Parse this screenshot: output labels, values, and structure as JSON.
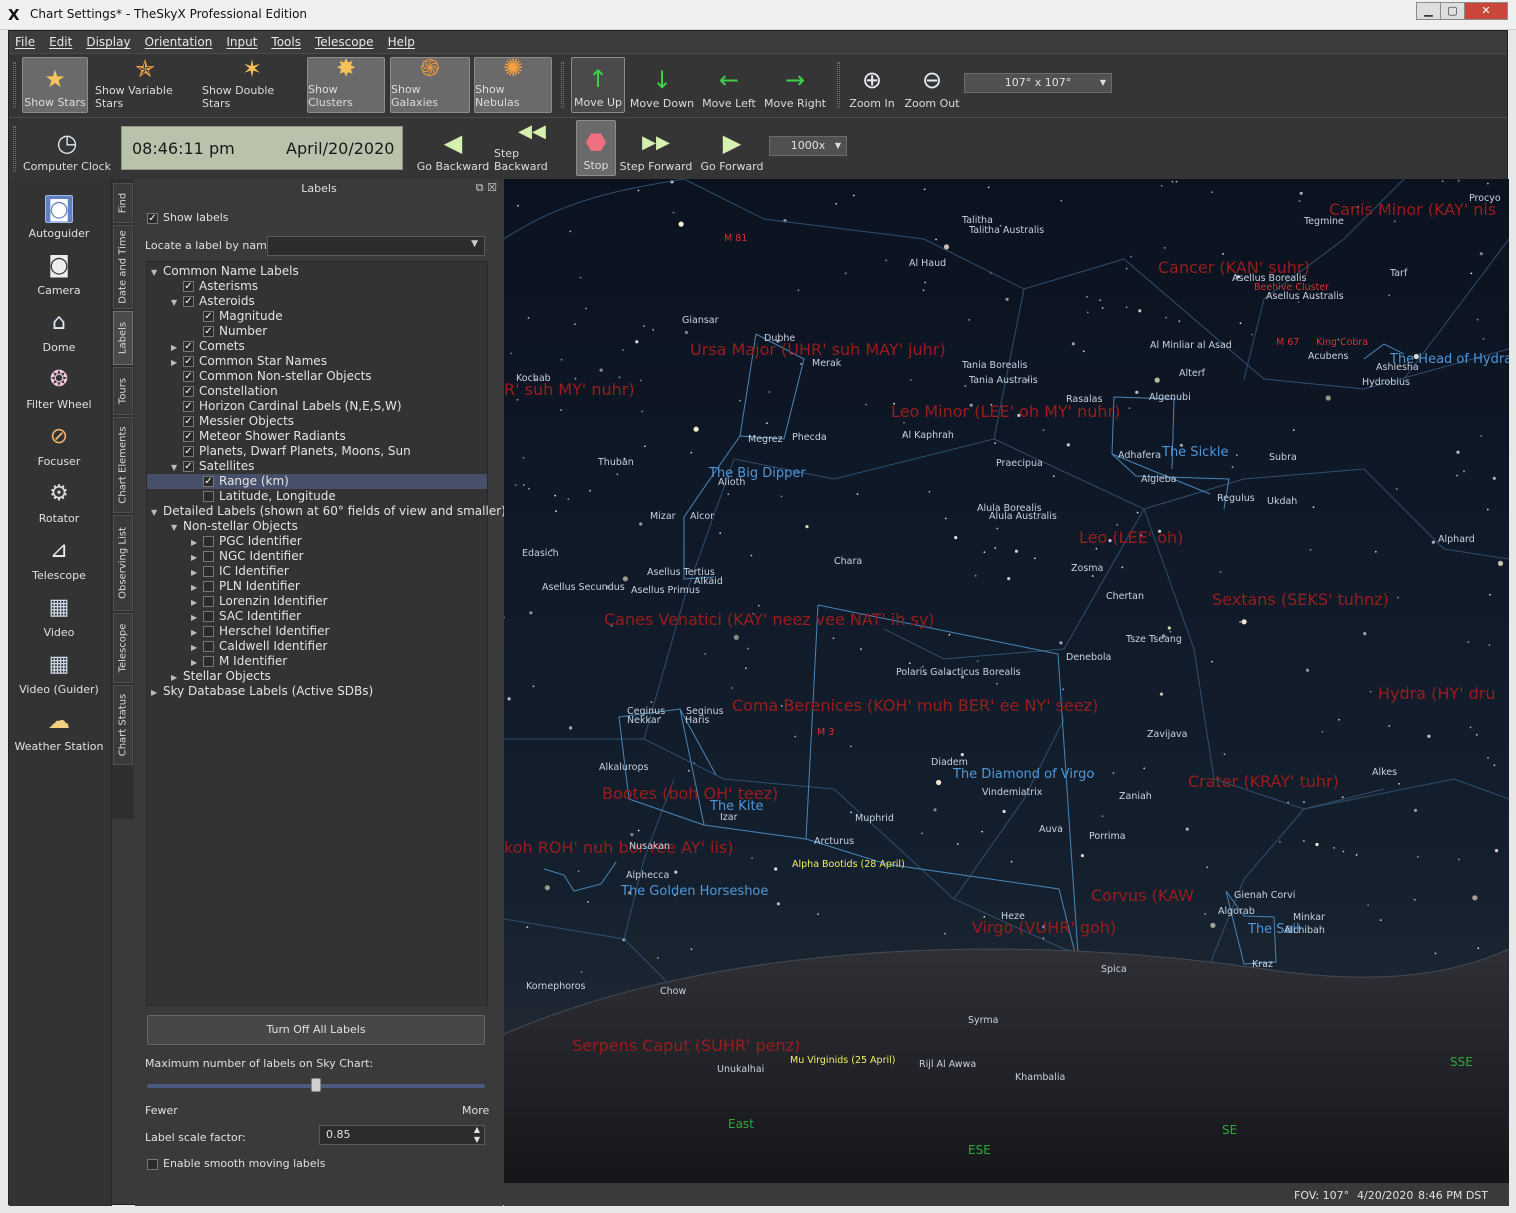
{
  "window": {
    "title": "Chart Settings* - TheSkyX Professional Edition",
    "logo": "X",
    "min": "▁",
    "max": "▢",
    "close": "✕"
  },
  "menu": [
    "File",
    "Edit",
    "Display",
    "Orientation",
    "Input",
    "Tools",
    "Telescope",
    "Help"
  ],
  "toolbar1": {
    "tools": [
      {
        "label": "Show Stars",
        "icon": "star-icon",
        "glyph": "★",
        "active": true
      },
      {
        "label": "Show Variable Stars",
        "icon": "variable-star-icon",
        "glyph": "✯",
        "active": false
      },
      {
        "label": "Show Double Stars",
        "icon": "double-star-icon",
        "glyph": "✶",
        "active": false
      },
      {
        "label": "Show Clusters",
        "icon": "cluster-icon",
        "glyph": "✸",
        "active": true
      },
      {
        "label": "Show Galaxies",
        "icon": "galaxy-icon",
        "glyph": "֍",
        "active": true
      },
      {
        "label": "Show Nebulas",
        "icon": "nebula-icon",
        "glyph": "✺",
        "active": true
      },
      {
        "label": "Move Up",
        "icon": "arrow-up-icon",
        "glyph": "↑",
        "active": true
      },
      {
        "label": "Move Down",
        "icon": "arrow-down-icon",
        "glyph": "↓",
        "active": false
      },
      {
        "label": "Move Left",
        "icon": "arrow-left-icon",
        "glyph": "←",
        "active": false
      },
      {
        "label": "Move Right",
        "icon": "arrow-right-icon",
        "glyph": "→",
        "active": false
      },
      {
        "label": "Zoom In",
        "icon": "zoom-in-icon",
        "glyph": "⊕",
        "active": false
      },
      {
        "label": "Zoom Out",
        "icon": "zoom-out-icon",
        "glyph": "⊖",
        "active": false
      }
    ],
    "fov": "107° x 107°"
  },
  "toolbar2": {
    "computer_clock": "Computer Clock",
    "time": "08:46:11 pm",
    "date": "April/20/2020",
    "buttons": [
      {
        "label": "Go Backward",
        "glyph": "◀"
      },
      {
        "label": "Step Backward",
        "glyph": "◀◀"
      },
      {
        "label": "Stop",
        "glyph": "⬣"
      },
      {
        "label": "Step Forward",
        "glyph": "▶▶"
      },
      {
        "label": "Go Forward",
        "glyph": "▶"
      }
    ],
    "rate": "1000x"
  },
  "dock": [
    {
      "label": "Autoguider",
      "glyph": "◙",
      "selected": true
    },
    {
      "label": "Camera",
      "glyph": "◙"
    },
    {
      "label": "Dome",
      "glyph": "⌂"
    },
    {
      "label": "Filter Wheel",
      "glyph": "❂"
    },
    {
      "label": "Focuser",
      "glyph": "⊘"
    },
    {
      "label": "Rotator",
      "glyph": "⚙"
    },
    {
      "label": "Telescope",
      "glyph": "⊿"
    },
    {
      "label": "Video",
      "glyph": "▦"
    },
    {
      "label": "Video (Guider)",
      "glyph": "▦"
    },
    {
      "label": "Weather Station",
      "glyph": "☁"
    }
  ],
  "vtabs": [
    "Find",
    "Date and Time",
    "Labels",
    "Tours",
    "Chart Elements",
    "Observing List",
    "Telescope",
    "Chart Status"
  ],
  "panel": {
    "title": "Labels",
    "show_labels": "Show labels",
    "locate_label": "Locate a label by name:",
    "tree": [
      {
        "text": "Common Name Labels",
        "level": 0,
        "twisty": "▼",
        "cb": null
      },
      {
        "text": "Asterisms",
        "level": 1,
        "twisty": "",
        "cb": true
      },
      {
        "text": "Asteroids",
        "level": 1,
        "twisty": "▼",
        "cb": true
      },
      {
        "text": "Magnitude",
        "level": 2,
        "twisty": "",
        "cb": true
      },
      {
        "text": "Number",
        "level": 2,
        "twisty": "",
        "cb": true
      },
      {
        "text": "Comets",
        "level": 1,
        "twisty": "▶",
        "cb": true
      },
      {
        "text": "Common Star Names",
        "level": 1,
        "twisty": "▶",
        "cb": true
      },
      {
        "text": "Common Non-stellar Objects",
        "level": 1,
        "twisty": "",
        "cb": true
      },
      {
        "text": "Constellation",
        "level": 1,
        "twisty": "",
        "cb": true
      },
      {
        "text": "Horizon Cardinal Labels (N,E,S,W)",
        "level": 1,
        "twisty": "",
        "cb": true
      },
      {
        "text": "Messier Objects",
        "level": 1,
        "twisty": "",
        "cb": true
      },
      {
        "text": "Meteor Shower Radiants",
        "level": 1,
        "twisty": "",
        "cb": true
      },
      {
        "text": "Planets, Dwarf Planets, Moons, Sun",
        "level": 1,
        "twisty": "",
        "cb": true
      },
      {
        "text": "Satellites",
        "level": 1,
        "twisty": "▼",
        "cb": true
      },
      {
        "text": "Range (km)",
        "level": 2,
        "twisty": "",
        "cb": true,
        "selected": true
      },
      {
        "text": "Latitude, Longitude",
        "level": 2,
        "twisty": "",
        "cb": false
      },
      {
        "text": "Detailed Labels (shown at 60° fields of view and smaller)",
        "level": 0,
        "twisty": "▼",
        "cb": null
      },
      {
        "text": "Non-stellar Objects",
        "level": 1,
        "twisty": "▼",
        "cb": null
      },
      {
        "text": "PGC Identifier",
        "level": 2,
        "twisty": "▶",
        "cb": false
      },
      {
        "text": "NGC Identifier",
        "level": 2,
        "twisty": "▶",
        "cb": false
      },
      {
        "text": "IC Identifier",
        "level": 2,
        "twisty": "▶",
        "cb": false
      },
      {
        "text": "PLN Identifier",
        "level": 2,
        "twisty": "▶",
        "cb": false
      },
      {
        "text": "Lorenzin Identifier",
        "level": 2,
        "twisty": "▶",
        "cb": false
      },
      {
        "text": "SAC Identifier",
        "level": 2,
        "twisty": "▶",
        "cb": false
      },
      {
        "text": "Herschel Identifier",
        "level": 2,
        "twisty": "▶",
        "cb": false
      },
      {
        "text": "Caldwell Identifier",
        "level": 2,
        "twisty": "▶",
        "cb": false
      },
      {
        "text": "M Identifier",
        "level": 2,
        "twisty": "▶",
        "cb": false
      },
      {
        "text": "Stellar Objects",
        "level": 1,
        "twisty": "▶",
        "cb": null
      },
      {
        "text": "Sky Database Labels (Active SDBs)",
        "level": 0,
        "twisty": "▶",
        "cb": null
      }
    ],
    "turn_off": "Turn Off All Labels",
    "max_labels": "Maximum number of labels on Sky Chart:",
    "max_labels_level": 0.5,
    "fewer": "Fewer",
    "more": "More",
    "scale_label": "Label scale factor:",
    "scale_value": "0.85",
    "smooth": "Enable smooth moving labels"
  },
  "status": {
    "fov": "FOV: 107°",
    "date": "4/20/2020",
    "time": "8:46 PM DST"
  },
  "sky": {
    "constellations": [
      "Canis Minor (KAY' nis",
      "Cancer (KAN' suhr)",
      "Ursa Major (UHR' suh  MAY' juhr)",
      "R' suh  MY' nuhr)",
      "Leo Minor (LEE' oh  MY' nuhr)",
      "Leo (LEE' oh)",
      "Sextans (SEKS' tuhnz)",
      "Canes Venatici (KAY' neez  vee NAT' ih sy)",
      "Coma Berenices (KOH' muh  BER' ee NY' seez)",
      "Hydra (HY' dru",
      "Bootes (boh OH' teez)",
      "Crater (KRAY' tuhr)",
      "koh ROH' nuh  bor ree AY' lis)",
      "Corvus (KAW",
      "Virgo (VUHR' goh)",
      "Serpens Caput (SUHR' penz)"
    ],
    "asterisms": [
      "The Big Dipper",
      "The Sickle",
      "The Diamond of Virgo",
      "The Kite",
      "The Golden Horseshoe",
      "The Sail",
      "The Head of Hydra"
    ],
    "stars": [
      "Talitha",
      "Talitha Australis",
      "Al Haud",
      "Dubhe",
      "Merak",
      "Tania Borealis",
      "Tania Australis",
      "Al Kaphrah",
      "Megrez",
      "Phecda",
      "Alioth",
      "Mizar",
      "Alcor",
      "Thuban",
      "Kochab",
      "Giansar",
      "Edasich",
      "Asellus Tertius",
      "Asellus Primus",
      "Asellus Secundus",
      "Alkaid",
      "Chara",
      "Praecipua",
      "Alula Borealis",
      "Alula Australis",
      "Zosma",
      "Chertan",
      "Denebola",
      "Tsze Tseang",
      "Polaris Galacticus Borealis",
      "Adhafera",
      "Algieba",
      "Regulus",
      "Rasalas",
      "Algenubi",
      "Alterf",
      "Al Minliar al Asad",
      "Subra",
      "Ukdah",
      "Alphard",
      "Tegmine",
      "Tarf",
      "Asellus Borealis",
      "Asellus Australis",
      "Acubens",
      "Ashlesha",
      "Hydrobius",
      "Seginus",
      "Haris",
      "Ceginus",
      "Nekkar",
      "Alkalurops",
      "Izar",
      "Muphrid",
      "Arcturus",
      "Nusakan",
      "Alphecca",
      "Diadem",
      "Vindemiatrix",
      "Zaniah",
      "Zavijava",
      "Auva",
      "Porrima",
      "Heze",
      "Spica",
      "Gienah Corvi",
      "Algorab",
      "Minkar",
      "Alchibah",
      "Kraz",
      "Alkes",
      "Syrma",
      "Rijl Al Awwa",
      "Khambalia",
      "Unukalhai",
      "Kornephoros",
      "Chow",
      "Procyo"
    ],
    "other": [
      "M 81",
      "M 67",
      "King Cobra",
      "Beehive Cluster",
      "M 3",
      "Alpha Bootids (28 April)",
      "Mu Virginids (25 April)"
    ],
    "horizon": [
      "East",
      "ESE",
      "SE",
      "SSE"
    ]
  }
}
